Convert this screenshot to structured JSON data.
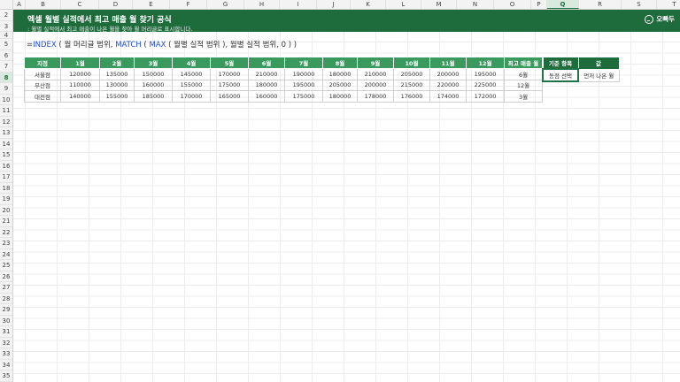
{
  "columns": [
    "A",
    "B",
    "C",
    "D",
    "E",
    "F",
    "G",
    "H",
    "I",
    "J",
    "K",
    "L",
    "M",
    "N",
    "O",
    "P",
    "Q",
    "R",
    "S",
    "T"
  ],
  "rows": [
    "2",
    "3",
    "4",
    "5",
    "6",
    "7",
    "8",
    "9",
    "10",
    "11",
    "12",
    "13",
    "14",
    "15",
    "16",
    "17",
    "18",
    "19",
    "20",
    "21",
    "22",
    "23",
    "24",
    "25",
    "26",
    "27",
    "28",
    "29",
    "30",
    "31",
    "32",
    "33",
    "34",
    "35"
  ],
  "selected_column": "Q",
  "selected_row": "8",
  "banner": {
    "title": "엑셀 월별 실적에서 최고 매출 월 찾기 공식",
    "subtitle": ": 월별 실적에서 최고 매출이 나온 월을 찾아 월 머리글로 표시합니다.",
    "logo_text": "오빠두"
  },
  "formula": {
    "eq": "=",
    "fn1": "INDEX",
    "a1": " ( 월 머리글 범위, ",
    "fn2": "MATCH",
    "a2": " ( ",
    "fn3": "MAX",
    "a3": " ( 월별 실적 범위 ), 월별 실적 범위, 0 ) )"
  },
  "table": {
    "headers": [
      "지점",
      "1월",
      "2월",
      "3월",
      "4월",
      "5월",
      "6월",
      "7월",
      "8월",
      "9월",
      "10월",
      "11월",
      "12월",
      "최고 매출 월"
    ],
    "rows": [
      [
        "서울점",
        "120000",
        "135000",
        "150000",
        "145000",
        "170000",
        "210000",
        "190000",
        "180000",
        "210000",
        "205000",
        "200000",
        "195000",
        "6월"
      ],
      [
        "부산점",
        "110000",
        "130000",
        "160000",
        "155000",
        "175000",
        "180000",
        "195000",
        "205000",
        "200000",
        "215000",
        "220000",
        "225000",
        "12월"
      ],
      [
        "대전점",
        "140000",
        "155000",
        "185000",
        "170000",
        "165000",
        "160000",
        "175000",
        "180000",
        "178000",
        "176000",
        "174000",
        "172000",
        "3월"
      ]
    ]
  },
  "criteria": {
    "headers": [
      "기준 항목",
      "값"
    ],
    "row": [
      "동점 선택",
      "먼저 나온 월"
    ]
  }
}
